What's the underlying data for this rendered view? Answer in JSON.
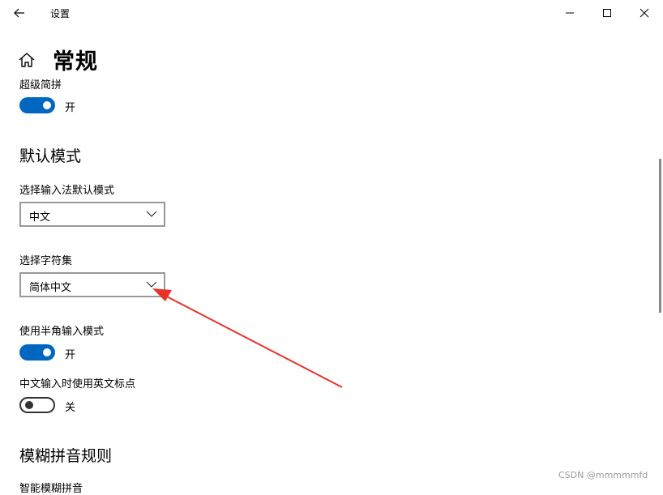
{
  "window": {
    "title": "设置"
  },
  "page": {
    "title": "常规"
  },
  "super_jianpin": {
    "label": "超级简拼",
    "state": "开",
    "on": true
  },
  "default_mode_section": {
    "heading": "默认模式",
    "input_mode": {
      "label": "选择输入法默认模式",
      "value": "中文"
    },
    "charset": {
      "label": "选择字符集",
      "value": "简体中文"
    },
    "halfwidth": {
      "label": "使用半角输入模式",
      "state": "开",
      "on": true
    },
    "english_punct": {
      "label": "中文输入时使用英文标点",
      "state": "关",
      "on": false
    }
  },
  "fuzzy_section": {
    "heading": "模糊拼音规则",
    "next_label": "智能模糊拼音"
  },
  "watermark": "CSDN @mmmmmfd",
  "colors": {
    "accent": "#0067c0",
    "annotation_arrow": "#e8322a"
  },
  "icons": [
    "back-arrow-icon",
    "minimize-icon",
    "maximize-icon",
    "close-icon",
    "home-icon",
    "chevron-down-icon"
  ]
}
